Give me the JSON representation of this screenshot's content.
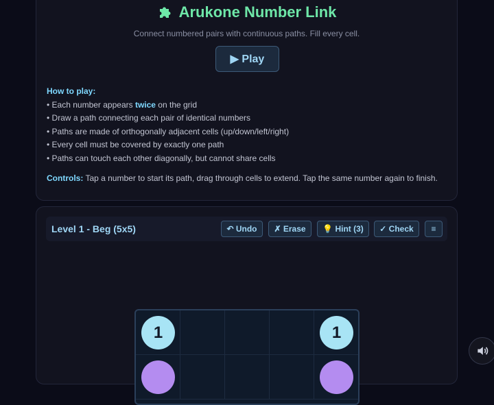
{
  "header": {
    "title": "Arukone Number Link",
    "subtitle": "Connect numbered pairs with continuous paths. Fill every cell.",
    "play_label": "▶ Play"
  },
  "howto": {
    "heading": "How to play:",
    "rule1_pre": "• Each number appears ",
    "rule1_em": "twice",
    "rule1_post": " on the grid",
    "rule2": "• Draw a path connecting each pair of identical numbers",
    "rule3": "• Paths are made of orthogonally adjacent cells (up/down/left/right)",
    "rule4": "• Every cell must be covered by exactly one path",
    "rule5": "• Paths can touch each other diagonally, but cannot share cells",
    "controls_label": "Controls:",
    "controls_text": " Tap a number to start its path, drag through cells to extend. Tap the same number again to finish."
  },
  "toolbar": {
    "level": "Level 1 - Beg (5x5)",
    "undo": "↶ Undo",
    "erase": "✗ Erase",
    "hint": "💡 Hint (3)",
    "check": "✓ Check",
    "menu": "≡"
  },
  "board": {
    "size": 5,
    "row0": {
      "c0": "1",
      "c4": "1"
    },
    "colors": {
      "one": "#a8e4f5",
      "two": "#b48cf0",
      "grid": "#1d2b40"
    }
  },
  "icons": {
    "title": "puzzle-icon",
    "sound": "speaker-icon"
  }
}
